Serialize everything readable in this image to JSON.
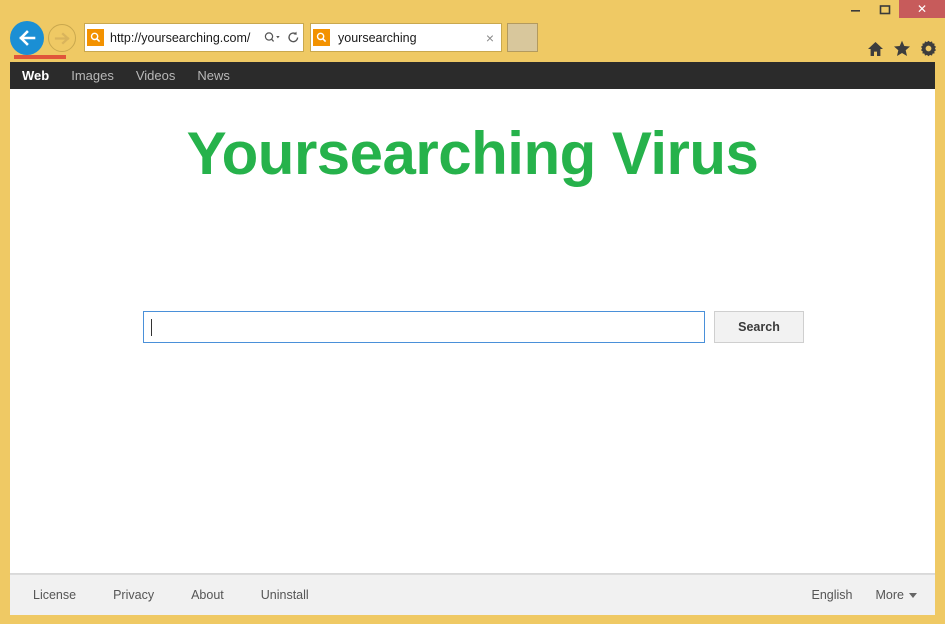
{
  "window": {
    "minimize_label": "minimize-icon",
    "maximize_label": "maximize-icon",
    "close_label": "✕"
  },
  "toolbar": {
    "back_icon": "back-arrow-icon",
    "forward_icon": "forward-arrow-icon",
    "url": "http://yoursearching.com/",
    "url_protocol": "http://",
    "url_host": "yoursearching.com/",
    "favicon_name": "search-favicon",
    "search_dropdown_icon": "magnifier-caret-icon",
    "refresh_icon": "refresh-icon",
    "home_icon": "home-icon",
    "favorites_icon": "star-icon",
    "settings_icon": "gear-icon"
  },
  "tab": {
    "title": "yoursearching",
    "close_label": "×",
    "new_tab_label": ""
  },
  "sitenav": {
    "items": [
      {
        "label": "Web",
        "active": true
      },
      {
        "label": "Images",
        "active": false
      },
      {
        "label": "Videos",
        "active": false
      },
      {
        "label": "News",
        "active": false
      }
    ]
  },
  "main": {
    "logo_text": "Yoursearching Virus",
    "search_value": "",
    "search_placeholder": "",
    "search_button_label": "Search"
  },
  "footer": {
    "links": [
      "License",
      "Privacy",
      "About",
      "Uninstall"
    ],
    "language": "English",
    "more_label": "More"
  },
  "colors": {
    "chrome": "#efc964",
    "navbar": "#2b2b2b",
    "logo_green": "#26b24b",
    "close_red": "#c75b5b",
    "focus_blue": "#4a90d9",
    "back_blue": "#1b8fd4",
    "favicon_orange": "#f39200",
    "footer_bg": "#f1f1f1"
  }
}
